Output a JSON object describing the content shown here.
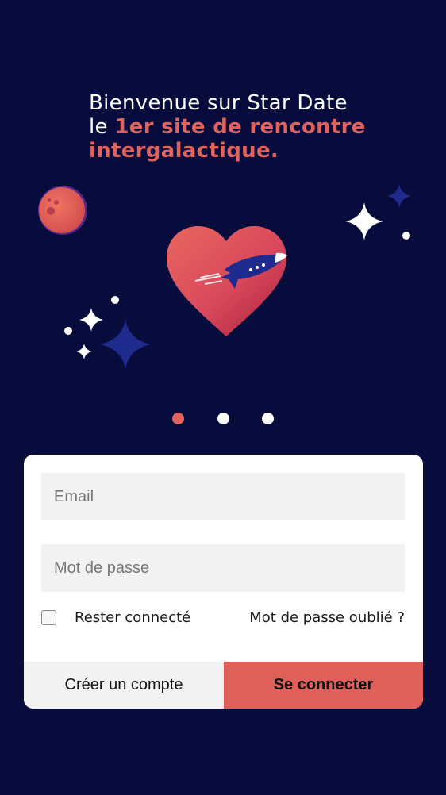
{
  "hero": {
    "line1": "Bienvenue sur Star Date",
    "line2_prefix": "le ",
    "line2_accent": "1er site de rencontre",
    "line3_accent": "intergalactique."
  },
  "carousel": {
    "pages": 3,
    "active_index": 0
  },
  "form": {
    "email_placeholder": "Email",
    "password_placeholder": "Mot de passe",
    "remember_label": "Rester connecté",
    "remember_checked": false,
    "forgot_label": "Mot de passe oublié ?",
    "create_account_label": "Créer un compte",
    "login_label": "Se connecter"
  },
  "colors": {
    "background": "#080c3d",
    "accent": "#e0635d",
    "star_blue": "#1e2a8c",
    "card": "#ffffff",
    "field": "#f2f2f2"
  },
  "icons": [
    "planet-icon",
    "heart-icon",
    "rocket-icon",
    "sparkle-icon"
  ]
}
